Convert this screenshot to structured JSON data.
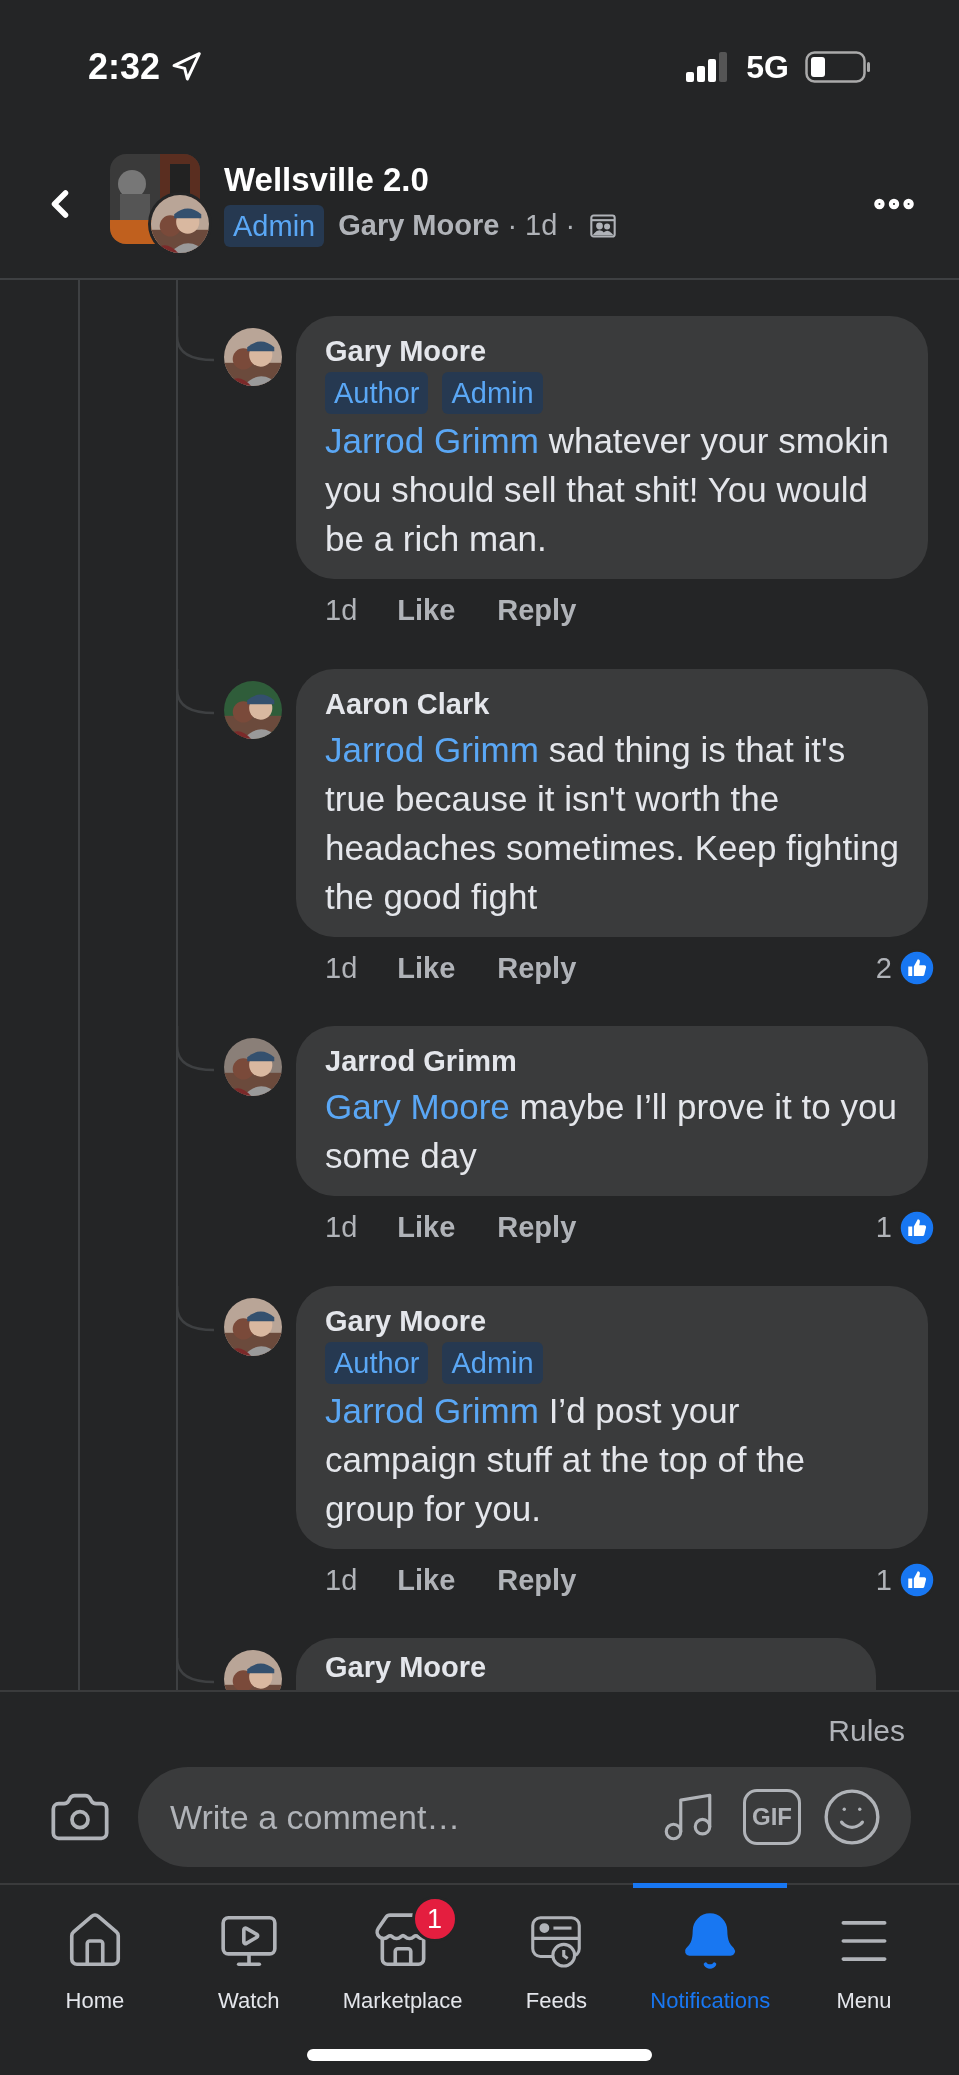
{
  "status_bar": {
    "time": "2:32",
    "network": "5G"
  },
  "header": {
    "title": "Wellsville 2.0",
    "badge": "Admin",
    "author": "Gary Moore",
    "meta": "· 1d ·"
  },
  "comments": [
    {
      "author": "Gary Moore",
      "badges": [
        "Author",
        "Admin"
      ],
      "mention": "Jarrod Grimm",
      "text": "whatever your smokin you should sell that shit! You would be a rich man.",
      "time": "1d",
      "actions": [
        "Like",
        "Reply"
      ]
    },
    {
      "author": "Aaron Clark",
      "mention": "Jarrod Grimm",
      "text": "sad thing is that it's true because it isn't worth the headaches sometimes.  Keep fighting the good fight",
      "time": "1d",
      "actions": [
        "Like",
        "Reply"
      ],
      "reactions": "2"
    },
    {
      "author": "Jarrod Grimm",
      "mention": "Gary Moore",
      "text": "maybe I’ll prove it to you some day",
      "time": "1d",
      "actions": [
        "Like",
        "Reply"
      ],
      "reactions": "1"
    },
    {
      "author": "Gary Moore",
      "badges": [
        "Author",
        "Admin"
      ],
      "mention": "Jarrod Grimm",
      "text": "I’d post your campaign stuff at the top of the group for you.",
      "time": "1d",
      "actions": [
        "Like",
        "Reply"
      ],
      "reactions": "1"
    },
    {
      "author": "Gary Moore"
    }
  ],
  "composer": {
    "rules": "Rules",
    "placeholder": "Write a comment…",
    "gif": "GIF"
  },
  "tabs": [
    {
      "label": "Home",
      "kind": "home",
      "selected": false
    },
    {
      "label": "Watch",
      "kind": "watch",
      "selected": false
    },
    {
      "label": "Marketplace",
      "kind": "store",
      "selected": false,
      "badge": "1"
    },
    {
      "label": "Feeds",
      "kind": "feeds",
      "selected": false
    },
    {
      "label": "Notifications",
      "kind": "bell",
      "selected": true
    },
    {
      "label": "Menu",
      "kind": "menu",
      "selected": false
    }
  ]
}
